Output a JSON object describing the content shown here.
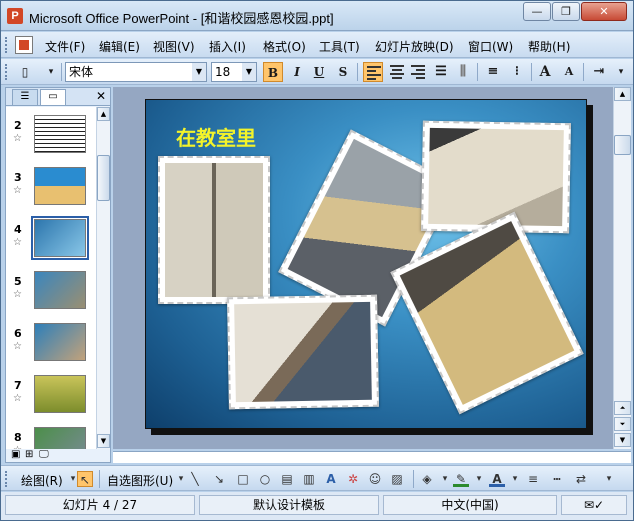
{
  "window": {
    "title": "Microsoft Office PowerPoint - [和谐校园感恩校园.ppt]",
    "app_icon_letter": "P",
    "minimize": "—",
    "restore": "❐",
    "close": "✕"
  },
  "menu": {
    "items": [
      "文件(F)",
      "编辑(E)",
      "视图(V)",
      "插入(I)",
      "格式(O)",
      "工具(T)",
      "幻灯片放映(D)",
      "窗口(W)",
      "帮助(H)"
    ]
  },
  "toolbar": {
    "font_name": "宋体",
    "font_size": "18",
    "bold": "B",
    "italic": "I",
    "underline": "U",
    "shadow": "S",
    "increase_font": "A",
    "decrease_font": "A"
  },
  "panel": {
    "close": "✕",
    "slides": [
      {
        "num": "2"
      },
      {
        "num": "3"
      },
      {
        "num": "4",
        "selected": true
      },
      {
        "num": "5"
      },
      {
        "num": "6"
      },
      {
        "num": "7"
      },
      {
        "num": "8"
      }
    ]
  },
  "slide": {
    "title": "在教室里"
  },
  "drawbar": {
    "draw_label": "绘图(R)",
    "autoshape_label": "自选图形(U)"
  },
  "status": {
    "slide_pos": "幻灯片 4 / 27",
    "template": "默认设计模板",
    "language": "中文(中国)"
  },
  "colors": {
    "accent_title": "#f3f32a",
    "selected_button": "#ffc56b",
    "frame": "#b9d1ea"
  }
}
